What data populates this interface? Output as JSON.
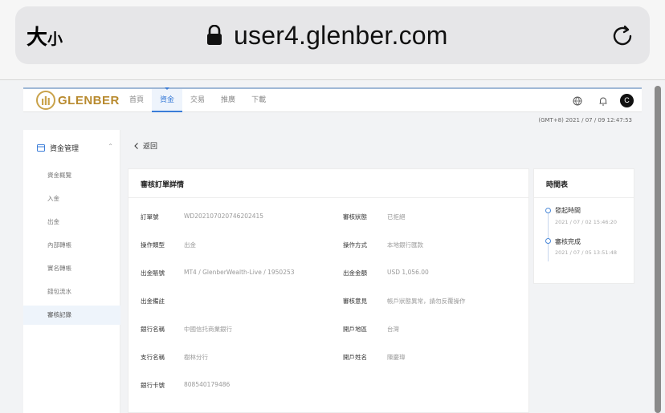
{
  "browser": {
    "text_size_big": "大",
    "text_size_small": "小",
    "url": "user4.glenber.com"
  },
  "nav": {
    "logo": "GLENBER",
    "menu": [
      "首頁",
      "資金",
      "交易",
      "推廣",
      "下載"
    ],
    "avatar": "C"
  },
  "timestamp": "(GMT+8) 2021 / 07 / 09 12:47:53",
  "sidebar": {
    "header": "資金管理",
    "items": [
      "資金概覽",
      "入金",
      "出金",
      "內部轉帳",
      "實名轉帳",
      "錢包流水",
      "審核記錄"
    ]
  },
  "back": "返回",
  "detail": {
    "title": "審核訂單詳情",
    "left": [
      {
        "label": "訂單號",
        "value": "WD20210702074620241​5"
      },
      {
        "label": "操作類型",
        "value": "出金"
      },
      {
        "label": "出金賬號",
        "value": "MT4 / GlenberWealth-Live / 1950253"
      },
      {
        "label": "出金備註",
        "value": ""
      },
      {
        "label": "銀行名稱",
        "value": "中國信托商業銀行"
      },
      {
        "label": "支行名稱",
        "value": "樹林分行"
      },
      {
        "label": "銀行卡號",
        "value": "808540179486"
      }
    ],
    "right": [
      {
        "label": "審核狀態",
        "value": "已拒絕"
      },
      {
        "label": "操作方式",
        "value": "本地銀行匯款"
      },
      {
        "label": "出金金額",
        "value": "USD 1,056.00"
      },
      {
        "label": "審核意見",
        "value": "帳戶狀態異常，請勿反覆操作"
      },
      {
        "label": "開戶地區",
        "value": "台灣"
      },
      {
        "label": "開戶姓名",
        "value": "陳慶瑋"
      }
    ]
  },
  "timeline": {
    "title": "時間表",
    "events": [
      {
        "label": "發起時間",
        "time": "2021 / 07 / 02 15:46:20"
      },
      {
        "label": "審核完成",
        "time": "2021 / 07 / 05 13:51:48"
      }
    ]
  }
}
